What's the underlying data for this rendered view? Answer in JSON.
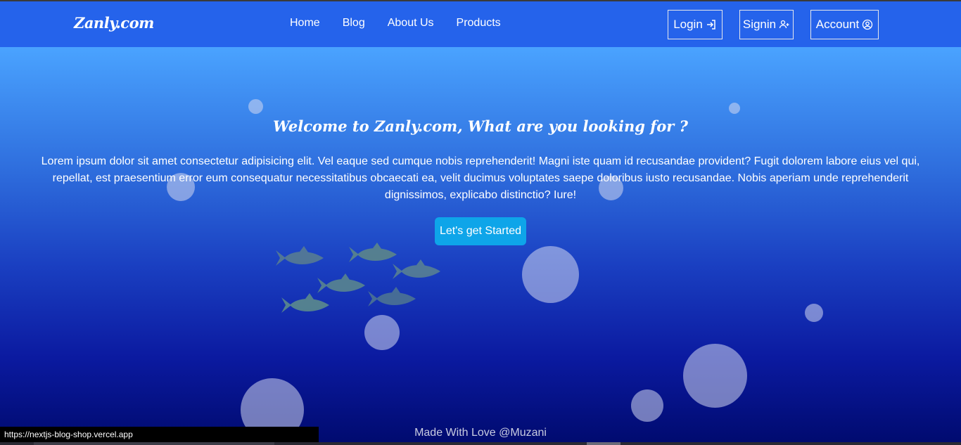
{
  "navbar": {
    "brand": "Zanly.com",
    "links": [
      "Home",
      "Blog",
      "About Us",
      "Products"
    ],
    "login_label": "Login",
    "signin_label": "Signin",
    "account_label": "Account"
  },
  "hero": {
    "title": "Welcome to Zanly.com, What are you looking for ?",
    "text": "Lorem ipsum dolor sit amet consectetur adipisicing elit. Vel eaque sed cumque nobis reprehenderit! Magni iste quam id recusandae provident? Fugit dolorem labore eius vel qui, repellat, est praesentium error eum consequatur necessitatibus obcaecati ea, velit ducimus voluptates saepe doloribus iusto recusandae. Nobis aperiam unde reprehenderit dignissimos, explicabo distinctio? Iure!",
    "cta_label": "Let's get Started"
  },
  "footer": {
    "text": "Made With Love @Muzani"
  },
  "status_url": "https://nextjs-blog-shop.vercel.app",
  "colors": {
    "navbar": "#2563eb",
    "cta": "#0ea5e9",
    "hero_top": "#4aa3ff",
    "hero_bottom": "#000a6e"
  }
}
